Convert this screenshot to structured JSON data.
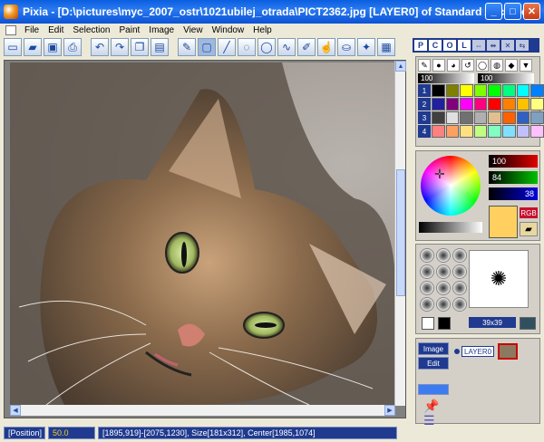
{
  "window": {
    "title": "Pixia - [D:\\pictures\\myc_2007_ostr\\1021ubilej_otrada\\PICT2362.jpg [LAYER0] of Standard Accuracy]",
    "minimize_icon": "minimize-icon",
    "maximize_icon": "maximize-icon",
    "close_icon": "close-icon"
  },
  "menu": {
    "items": [
      "File",
      "Edit",
      "Selection",
      "Paint",
      "Image",
      "View",
      "Window",
      "Help"
    ]
  },
  "toolbar": {
    "icons": [
      "new-file-icon",
      "open-folder-icon",
      "save-icon",
      "print-icon",
      "undo-icon",
      "redo-icon",
      "copy-icon",
      "paste-icon",
      "eraser-icon",
      "rect-select-icon",
      "line-icon",
      "lasso-icon",
      "ellipse-select-icon",
      "curve-icon",
      "brush-icon",
      "smudge-icon",
      "bucket-icon",
      "magic-wand-icon",
      "pattern-icon"
    ]
  },
  "panel_header": {
    "labels": [
      "P",
      "C",
      "O",
      "L"
    ]
  },
  "color_panel": {
    "opacity_value": "100",
    "size_value": "100",
    "row_numbers": [
      "1",
      "2",
      "3",
      "4"
    ],
    "swatch_rows": [
      [
        "#000000",
        "#808000",
        "#ffff00",
        "#80ff00",
        "#00ff00",
        "#00ff80",
        "#00ffff",
        "#0080ff"
      ],
      [
        "#2020a0",
        "#800080",
        "#ff00ff",
        "#ff0080",
        "#ff0000",
        "#ff8000",
        "#ffc000",
        "#ffff80"
      ],
      [
        "#404040",
        "#e0e0e0",
        "#707070",
        "#b0b0b0",
        "#e0c090",
        "#ff6000",
        "#3060c0",
        "#80a0c0"
      ],
      [
        "#ff8080",
        "#ffa060",
        "#ffe080",
        "#c0ff80",
        "#80ffc0",
        "#80e0ff",
        "#c0c0ff",
        "#ffc0ff"
      ]
    ]
  },
  "mixer": {
    "red_value": "100",
    "green_value": "84",
    "blue_value": "38",
    "rgb_label": "RGB",
    "current_color": "#ffd060"
  },
  "brush": {
    "size_label": "39x39"
  },
  "layers": {
    "image_button": "Image",
    "edit_button": "Edit",
    "layer_name": "LAYER0"
  },
  "status": {
    "position_label": "[Position]",
    "zoom_value": "50.0",
    "info": "[1895,919]-[2075,1230], Size[181x312], Center[1985,1074]"
  }
}
